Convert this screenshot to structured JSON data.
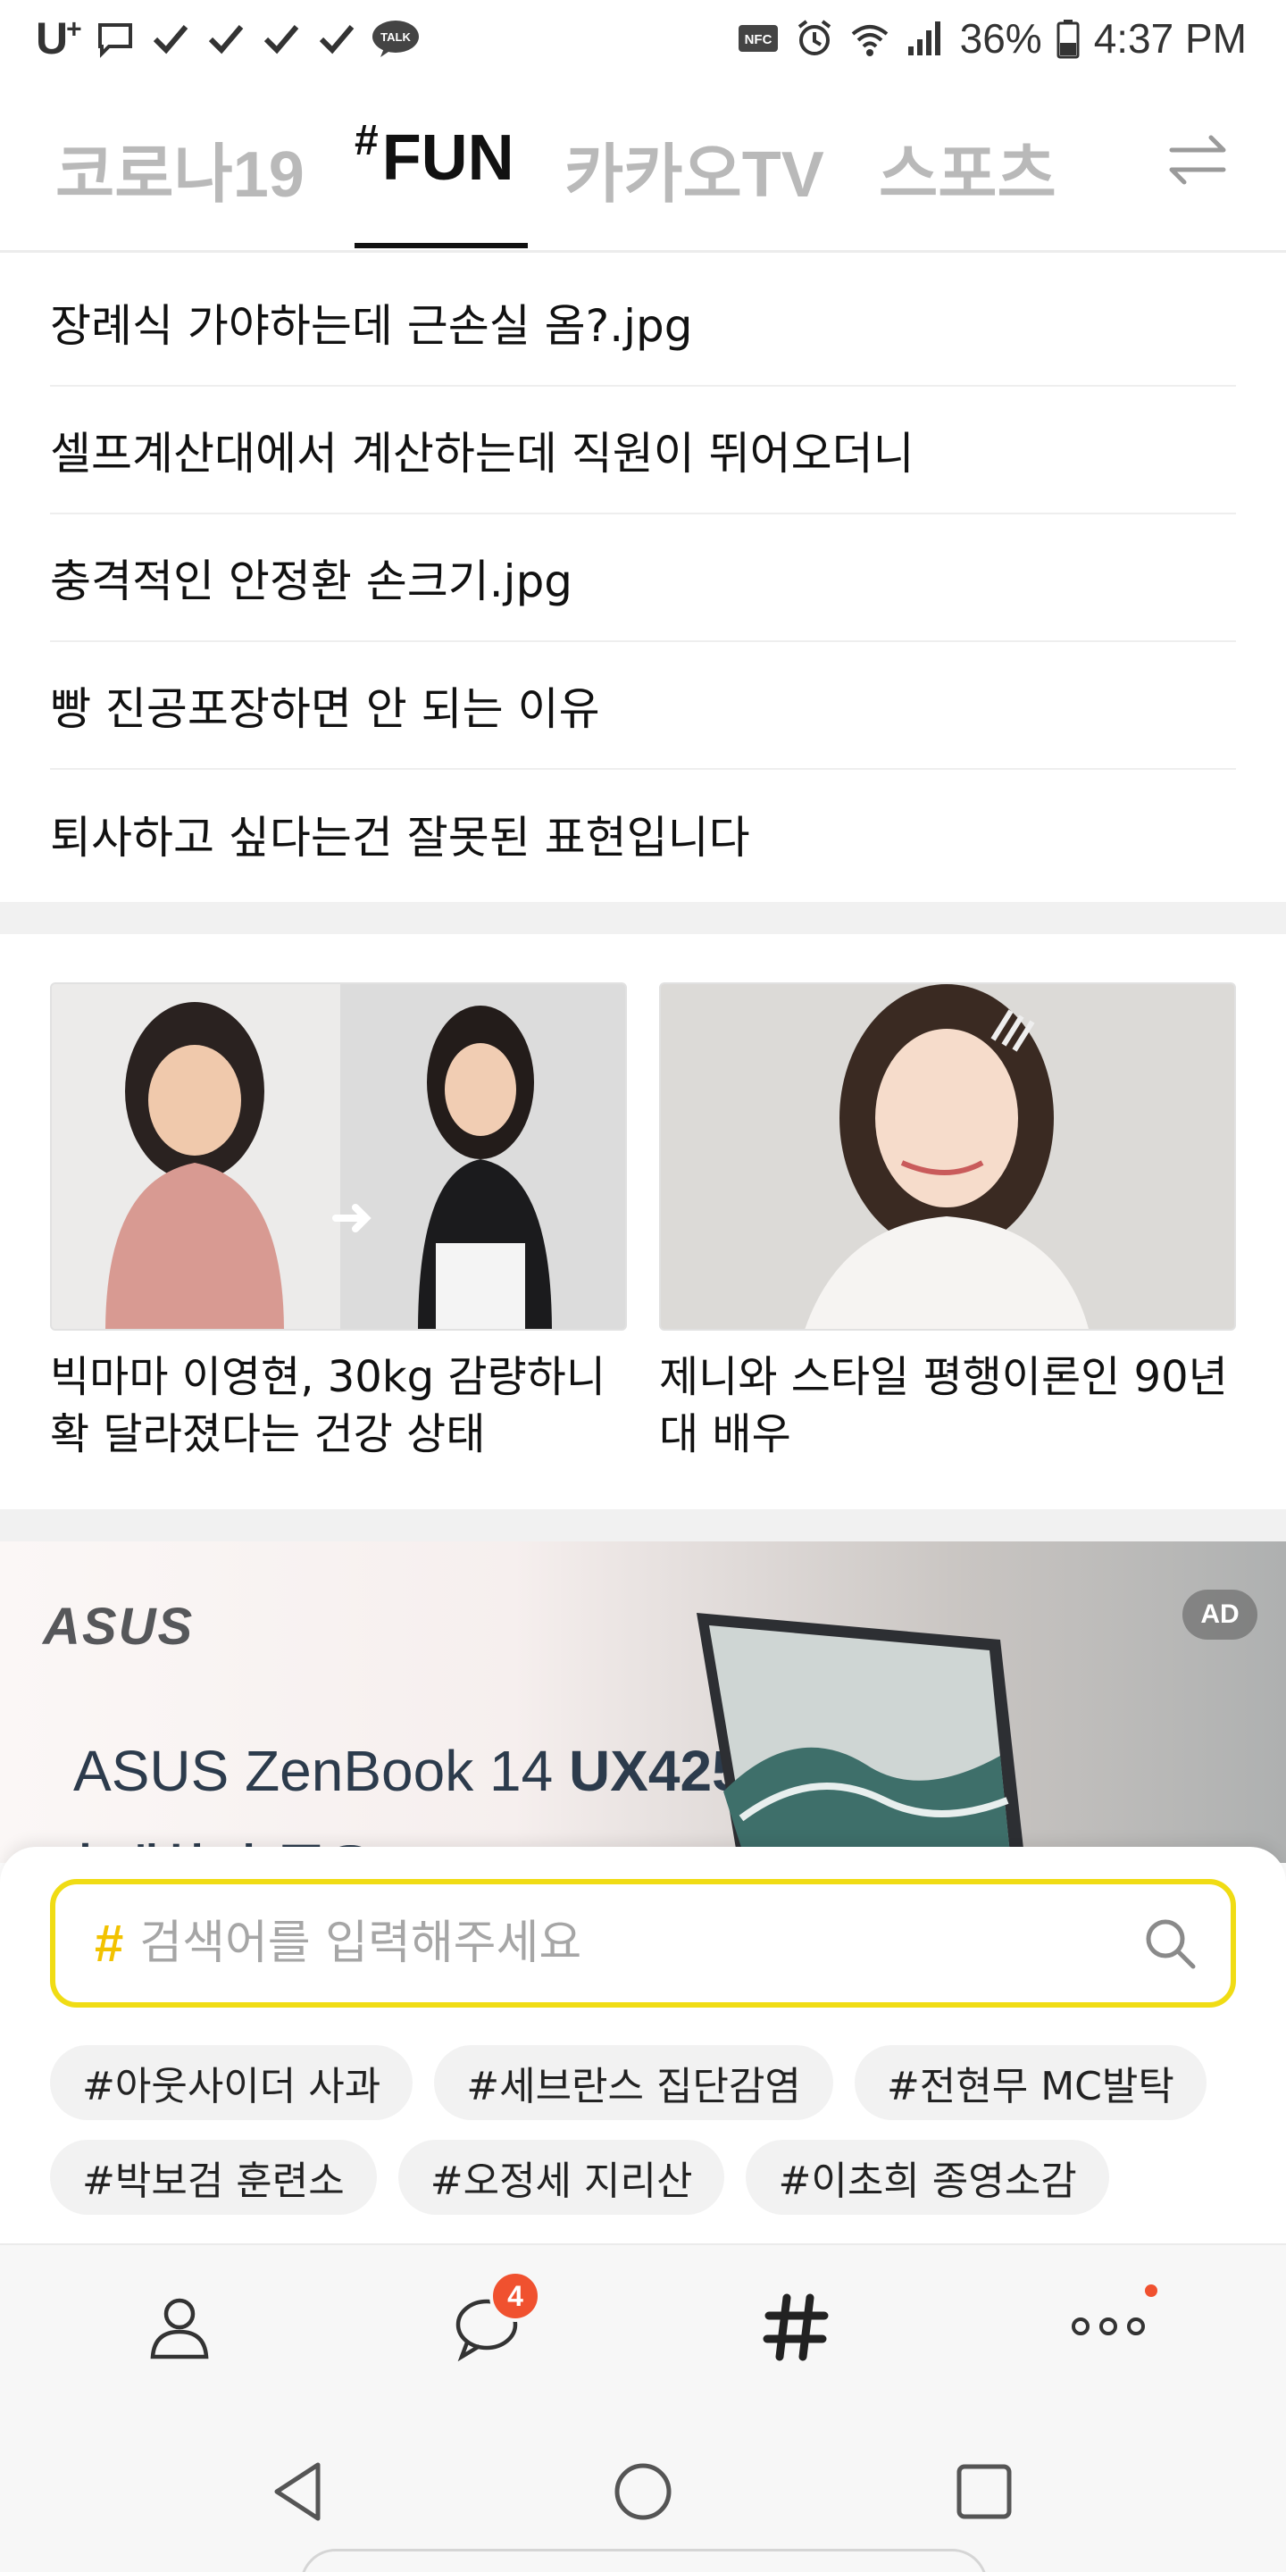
{
  "status_bar": {
    "carrier": "U",
    "carrier_sup": "+",
    "battery": "36%",
    "time": "4:37 PM",
    "icons": [
      "message-icon",
      "check-icon",
      "check-icon",
      "check-icon",
      "check-icon",
      "talk-icon",
      "nfc-icon",
      "alarm-icon",
      "wifi-icon",
      "signal-icon",
      "battery-icon"
    ],
    "talk_label": "TALK",
    "nfc_label": "NFC"
  },
  "tabs": [
    {
      "label": "코로나19",
      "active": false
    },
    {
      "hash": "#",
      "label": "FUN",
      "active": true
    },
    {
      "label": "카카오TV",
      "active": false
    },
    {
      "label": "스포츠",
      "active": false
    }
  ],
  "headlines": [
    "장례식 가야하는데 근손실 옴?.jpg",
    "셀프계산대에서 계산하는데 직원이 뛰어오더니",
    "충격적인 안정환 손크기.jpg",
    "빵 진공포장하면 안 되는 이유",
    "퇴사하고 싶다는건 잘못된 표현입니다"
  ],
  "cards": [
    {
      "caption": "빅마마 이영현, 30kg 감량하니 확 달라졌다는 건강 상태"
    },
    {
      "caption": "제니와 스타일 평행이론인 90년대 배우"
    }
  ],
  "ad": {
    "badge": "AD",
    "logo": "ASUS",
    "model_prefix": "ASUS Zen",
    "model_book": "Book",
    "model_num": " 14 ",
    "model_code": "UX425",
    "subtitle": "휴대하기 좋은"
  },
  "search": {
    "hash": "#",
    "placeholder": "검색어를 입력해주세요",
    "value": ""
  },
  "trending": [
    "#아웃사이더 사과",
    "#세브란스 집단감염",
    "#전현무 MC발탁",
    "#박보검 훈련소",
    "#오정세 지리산",
    "#이초희 종영소감"
  ],
  "bottom_nav": {
    "chat_badge": "4",
    "hash": "#"
  },
  "colors": {
    "search_border": "#f0dc14",
    "hash_accent": "#f2c200",
    "badge": "#f0512f"
  }
}
